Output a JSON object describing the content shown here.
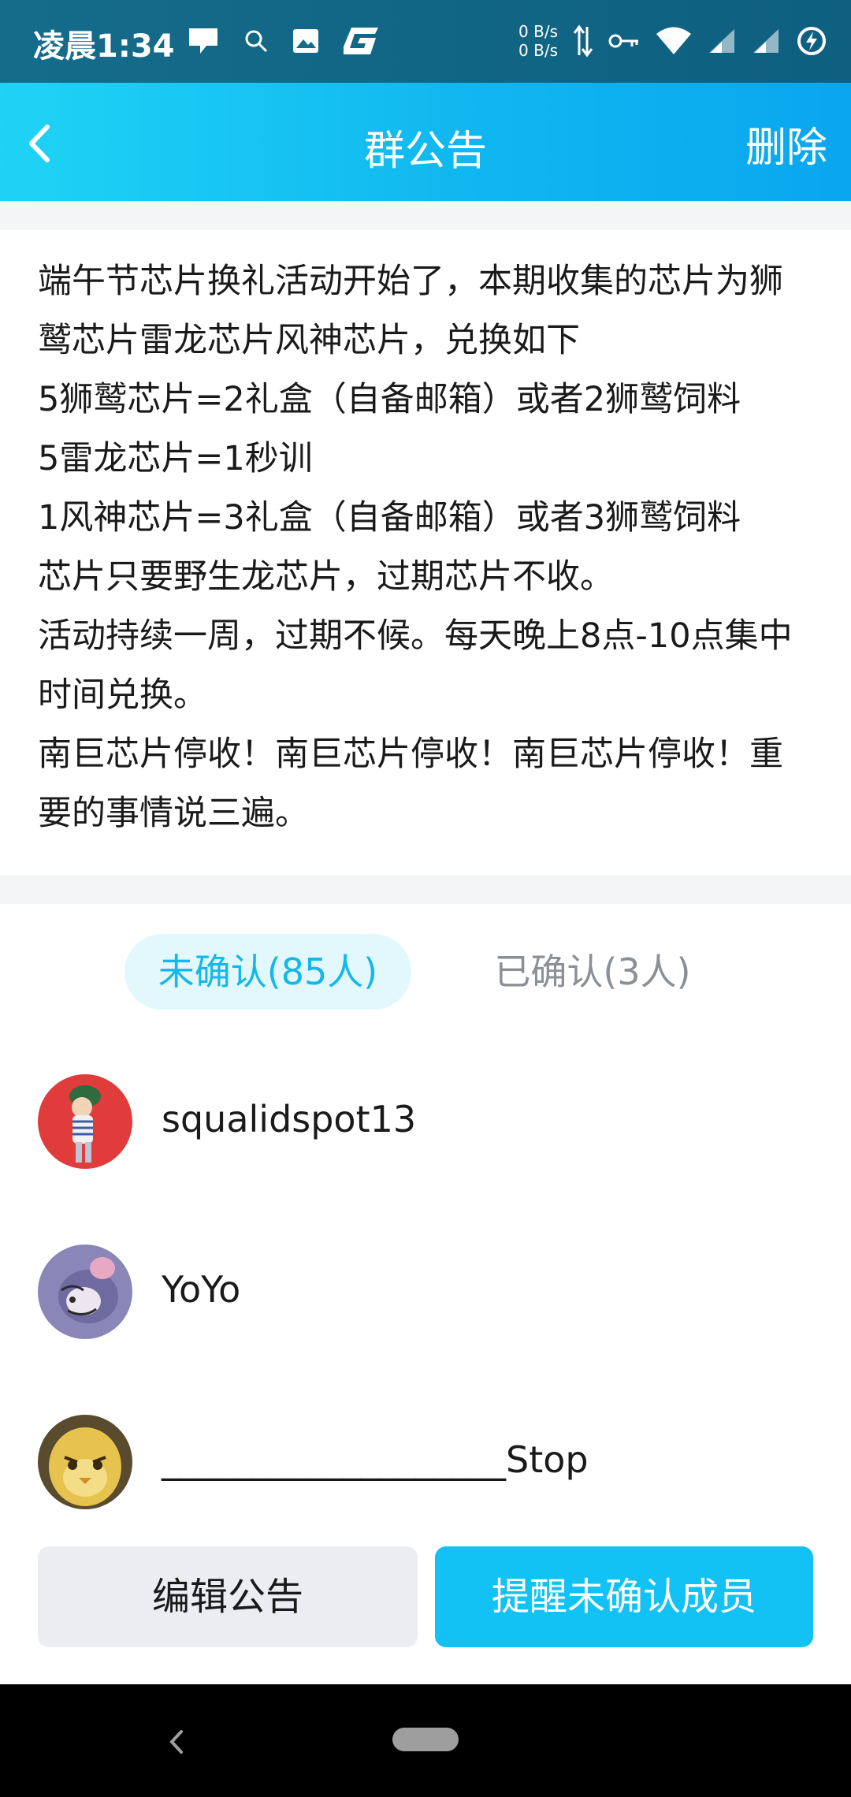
{
  "status_bar": {
    "time": "凌晨1:34",
    "net_speed_up": "0 B/s",
    "net_speed_down": "0 B/s",
    "icons": [
      "message-icon",
      "search-icon",
      "image-icon",
      "g-app-icon",
      "data-arrows-icon",
      "vpn-key-icon",
      "wifi-icon",
      "signal-icon",
      "signal-icon",
      "battery-icon"
    ]
  },
  "header": {
    "title": "群公告",
    "delete_label": "删除"
  },
  "announcement": {
    "text": "端午节芯片换礼活动开始了，本期收集的芯片为狮鹫芯片雷龙芯片风神芯片，兑换如下\n5狮鹫芯片=2礼盒（自备邮箱）或者2狮鹫饲料\n5雷龙芯片=1秒训\n1风神芯片=3礼盒（自备邮箱）或者3狮鹫饲料\n芯片只要野生龙芯片，过期芯片不收。\n活动持续一周，过期不候。每天晚上8点-10点集中时间兑换。\n南巨芯片停收！南巨芯片停收！南巨芯片停收！重要的事情说三遍。"
  },
  "tabs": {
    "unconfirmed": "未确认(85人)",
    "confirmed": "已确认(3人)"
  },
  "members": [
    {
      "name": "squalidspot13",
      "avatar_color": "#e03c3c"
    },
    {
      "name": "YoYo",
      "avatar_color": "#7b6fa8"
    },
    {
      "name": "___________________Stop",
      "avatar_color": "#d8b84a"
    }
  ],
  "actions": {
    "edit_label": "编辑公告",
    "remind_label": "提醒未确认成员"
  },
  "colors": {
    "accent": "#12c2f4",
    "header_gradient_start": "#1fd3f5",
    "header_gradient_end": "#0aa6ef",
    "tab_active_bg": "#e3f8fd"
  }
}
